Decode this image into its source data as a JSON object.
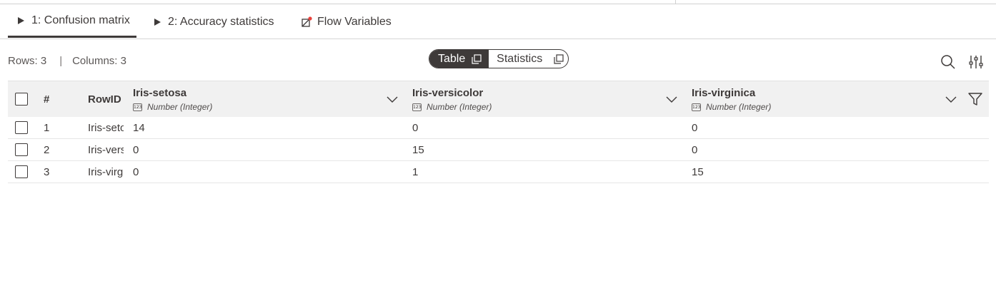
{
  "tabs": [
    {
      "label": "1: Confusion matrix",
      "icon": "play-icon",
      "active": true
    },
    {
      "label": "2: Accuracy statistics",
      "icon": "play-icon",
      "active": false
    },
    {
      "label": "Flow Variables",
      "icon": "flow-variable-icon",
      "active": false
    }
  ],
  "info": {
    "rows": "Rows: 3",
    "separator": "|",
    "columns": "Columns: 3"
  },
  "view_toggle": {
    "table_label": "Table",
    "statistics_label": "Statistics",
    "selected": "Table"
  },
  "toolbar": {
    "search_icon": "search-icon",
    "settings_icon": "sliders-icon"
  },
  "table": {
    "index_header": "#",
    "rowid_header": "RowID",
    "type_badge": "123",
    "columns": [
      {
        "name": "Iris-setosa",
        "type": "Number (Integer)"
      },
      {
        "name": "Iris-versicolor",
        "type": "Number (Integer)"
      },
      {
        "name": "Iris-virginica",
        "type": "Number (Integer)"
      }
    ],
    "rows": [
      {
        "index": "1",
        "rowid": "Iris-setosa",
        "values": [
          "14",
          "0",
          "0"
        ]
      },
      {
        "index": "2",
        "rowid": "Iris-versicolor",
        "values": [
          "0",
          "15",
          "0"
        ]
      },
      {
        "index": "3",
        "rowid": "Iris-virginica",
        "values": [
          "0",
          "1",
          "15"
        ]
      }
    ]
  },
  "colors": {
    "text": "#3e3a39",
    "header_bg": "#f1f1f1",
    "flow_variable_dot": "#e8413c"
  }
}
